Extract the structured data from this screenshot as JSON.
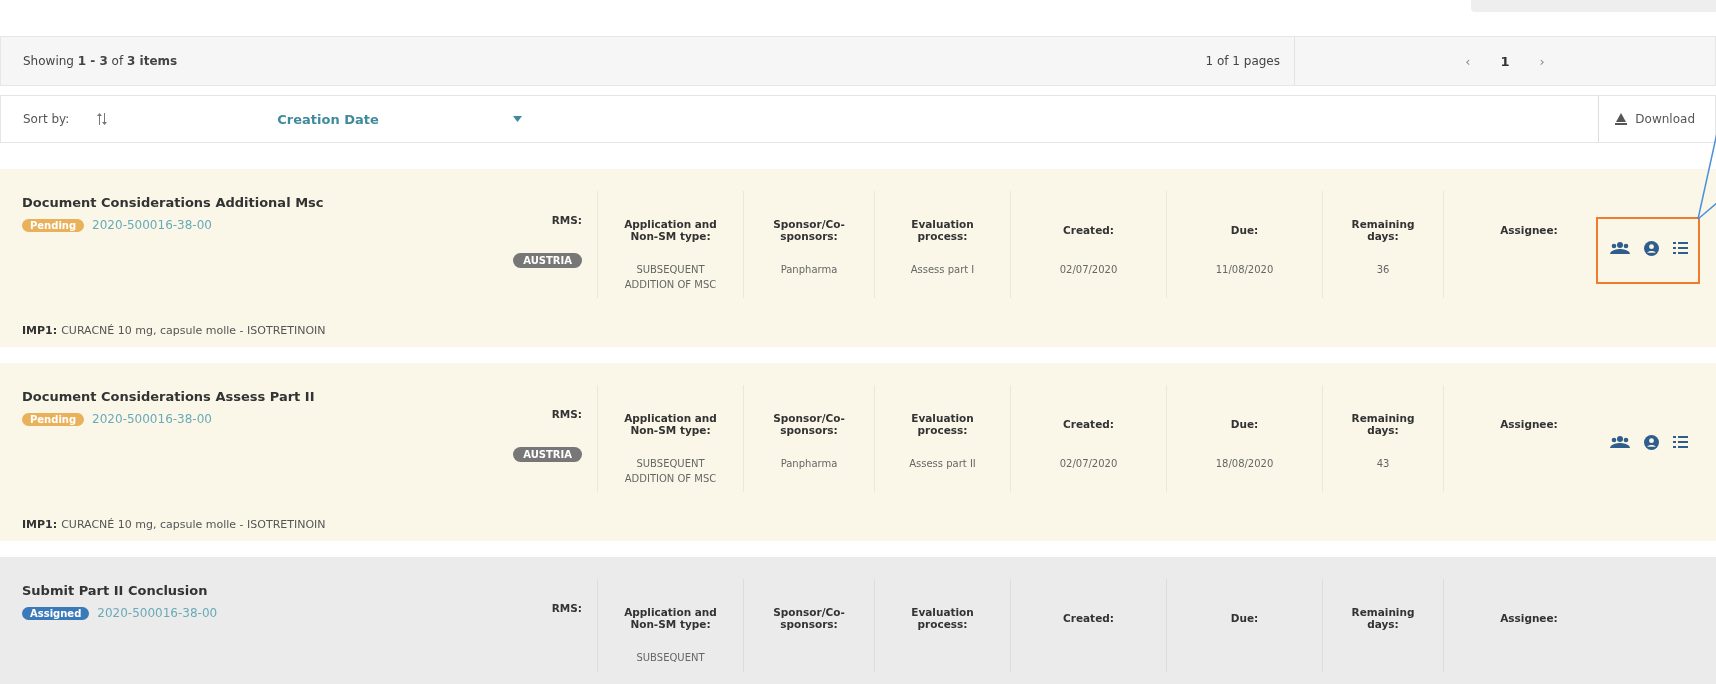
{
  "pager_bar": {
    "summary": "Showing **1 - 3** of **3 items**",
    "pages_label": "1 of 1 pages",
    "prev": {
      "label": "‹",
      "disabled": true
    },
    "pages": [
      {
        "label": "1",
        "selected": true
      }
    ],
    "next": {
      "label": "›",
      "disabled": true
    }
  },
  "sort_bar": {
    "label": "Sort by:",
    "field": "Creation Date",
    "download": "Download"
  },
  "tasks": [
    {
      "title": "Document Considerations Additional Msc",
      "status": {
        "label": "Pending",
        "kind": "pending"
      },
      "trial_id": "2020-500016-38-00",
      "labels": {
        "rms": "RMS:",
        "type": "Application and Non-SM type:",
        "sponsor": "Sponsor/Co-sponsors:",
        "process": "Evaluation process:",
        "created": "Created:",
        "due": "Due:",
        "remaining": "Remaining days:",
        "assignee": "Assignee:"
      },
      "rms": "AUSTRIA",
      "type": "SUBSEQUENT ADDITION OF MSC",
      "sponsor": "Panpharma",
      "process": "Assess part I",
      "created": "02/07/2020",
      "due": "11/08/2020",
      "remaining": "36",
      "actions": true,
      "annotated": true,
      "product_label": "IMP1:",
      "product": "CURACNÉ 10 mg, capsule molle - ISOTRETINOIN"
    },
    {
      "title": "Document Considerations Assess Part II",
      "status": {
        "label": "Pending",
        "kind": "pending"
      },
      "trial_id": "2020-500016-38-00",
      "labels": {
        "rms": "RMS:",
        "type": "Application and Non-SM type:",
        "sponsor": "Sponsor/Co-sponsors:",
        "process": "Evaluation process:",
        "created": "Created:",
        "due": "Due:",
        "remaining": "Remaining days:",
        "assignee": "Assignee:"
      },
      "rms": "AUSTRIA",
      "type": "SUBSEQUENT ADDITION OF MSC",
      "sponsor": "Panpharma",
      "process": "Assess part II",
      "created": "02/07/2020",
      "due": "18/08/2020",
      "remaining": "43",
      "actions": true,
      "annotated": false,
      "product_label": "IMP1:",
      "product": "CURACNÉ 10 mg, capsule molle - ISOTRETINOIN"
    },
    {
      "title": "Submit Part II Conclusion",
      "status": {
        "label": "Assigned",
        "kind": "assigned"
      },
      "trial_id": "2020-500016-38-00",
      "labels": {
        "rms": "RMS:",
        "type": "Application and Non-SM type:",
        "sponsor": "Sponsor/Co-sponsors:",
        "process": "Evaluation process:",
        "created": "Created:",
        "due": "Due:",
        "remaining": "Remaining days:",
        "assignee": "Assignee:"
      },
      "type": "SUBSEQUENT",
      "actions": false
    }
  ]
}
